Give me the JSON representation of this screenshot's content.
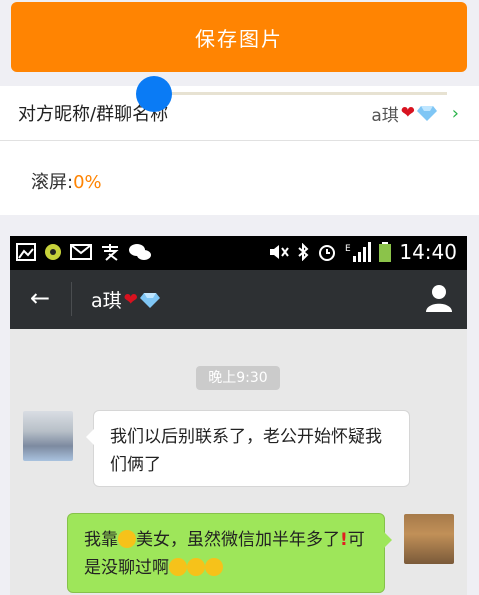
{
  "save_button": {
    "label": "保存图片"
  },
  "settings": {
    "nickname_label": "对方昵称/群聊名称",
    "nickname_value": "a琪",
    "scroll_label": "滚屏:",
    "scroll_value": "0%",
    "scroll_fraction": 0
  },
  "status_bar": {
    "time": "14:40"
  },
  "chat_header": {
    "title": "a琪"
  },
  "messages": [
    {
      "side": "left",
      "text": "我们以后别联系了，老公开始怀疑我们俩了"
    },
    {
      "side": "right",
      "text_a": "我靠",
      "text_b": "美女，虽然微信加半年多了",
      "text_c": "可是没聊过啊"
    }
  ],
  "timestamp": "晚上9:30",
  "colors": {
    "accent": "#ff8402",
    "slider": "#0a7bf5",
    "bubble_green": "#9ee65a",
    "chev": "#2ab34a"
  }
}
